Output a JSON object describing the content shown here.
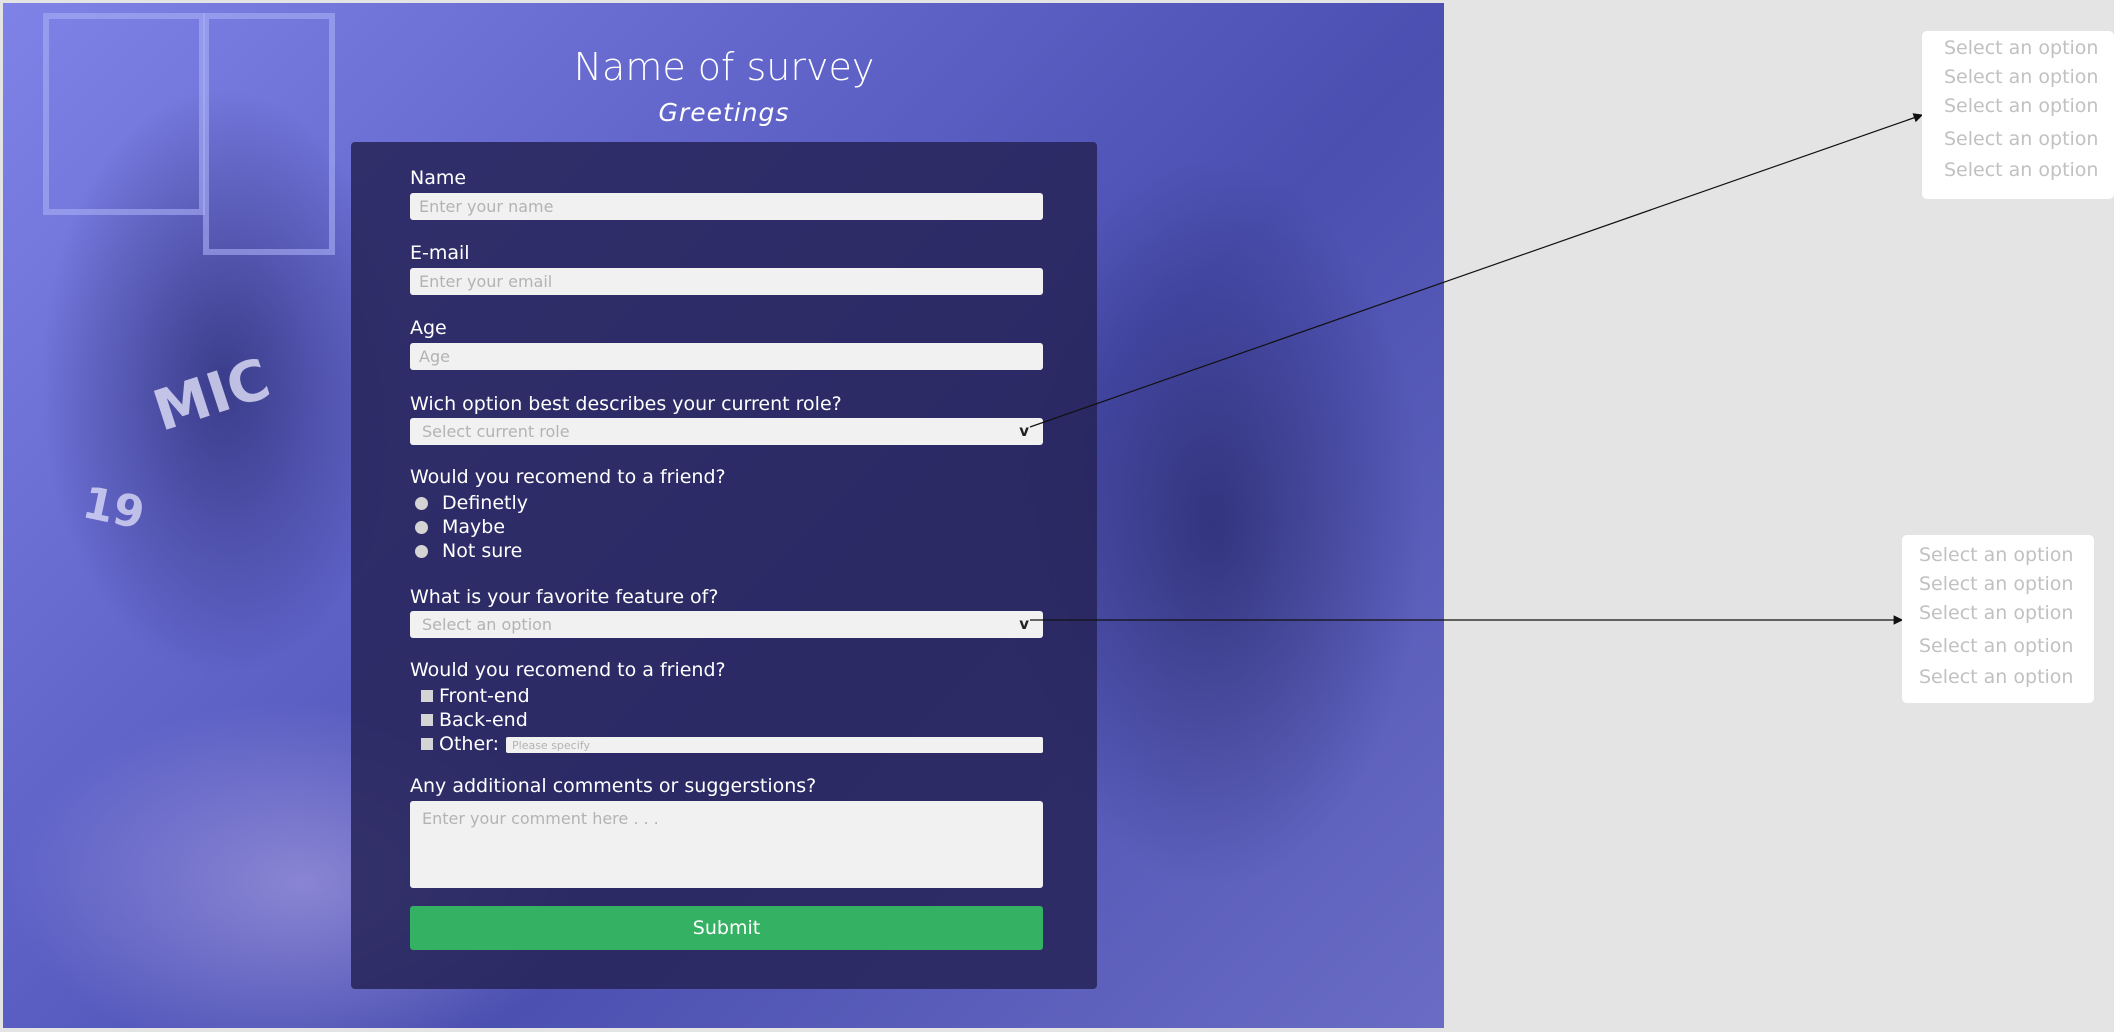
{
  "survey": {
    "title": "Name of survey",
    "subtitle": "Greetings"
  },
  "fields": {
    "name": {
      "label": "Name",
      "placeholder": "Enter your name"
    },
    "email": {
      "label": "E-mail",
      "placeholder": "Enter your email"
    },
    "age": {
      "label": "Age",
      "placeholder": "Age"
    },
    "role": {
      "label": "Wich option best describes your current role?",
      "placeholder": "Select current role",
      "chevron": "v"
    },
    "recommend": {
      "label": "Would you recomend to a friend?",
      "options": [
        "Definetly",
        "Maybe",
        "Not sure"
      ]
    },
    "feature": {
      "label": "What is your favorite feature of?",
      "placeholder": "Select an option",
      "chevron": "v"
    },
    "improve": {
      "label": "Would you recomend to a friend?",
      "options": [
        "Front-end",
        "Back-end",
        "Other:"
      ],
      "other_placeholder": "Please specify"
    },
    "comments": {
      "label": "Any additional comments or suggerstions?",
      "placeholder": "Enter your comment here . . ."
    },
    "submit_label": "Submit"
  },
  "dropdown_annotations": {
    "role_options": [
      "Select an option",
      "Select an option",
      "Select an option",
      "Select an option",
      "Select an option"
    ],
    "feature_options": [
      "Select an option",
      "Select an option",
      "Select an option",
      "Select an option",
      "Select an option"
    ]
  },
  "colors": {
    "page_bg": "#e4e4e4",
    "card_bg": "#262458",
    "submit_bg": "#34b163",
    "input_bg": "#f1f1f1"
  }
}
